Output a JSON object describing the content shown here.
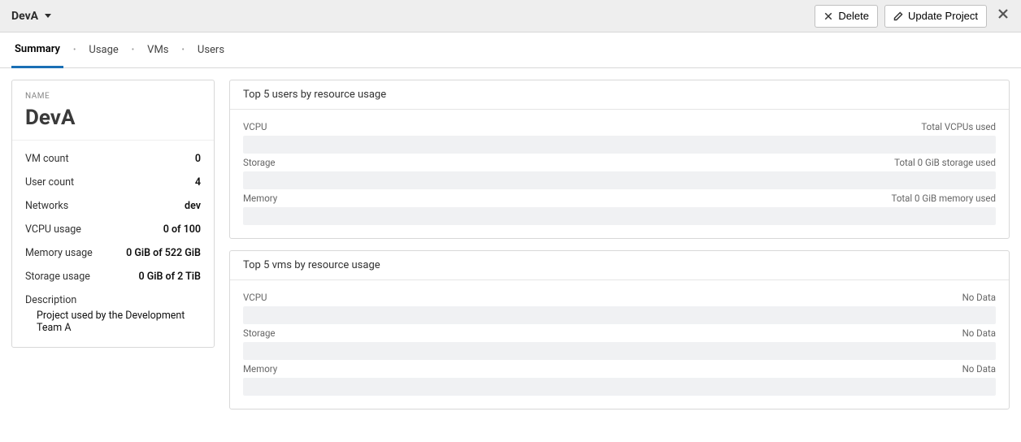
{
  "header": {
    "title": "DevA",
    "delete_label": "Delete",
    "update_label": "Update Project"
  },
  "tabs": {
    "summary": "Summary",
    "usage": "Usage",
    "vms": "VMs",
    "users": "Users"
  },
  "side": {
    "name_label": "NAME",
    "name_value": "DevA",
    "rows": {
      "vm_count_label": "VM count",
      "vm_count_value": "0",
      "user_count_label": "User count",
      "user_count_value": "4",
      "networks_label": "Networks",
      "networks_value": "dev",
      "vcpu_usage_label": "VCPU usage",
      "vcpu_usage_value": "0 of 100",
      "memory_usage_label": "Memory usage",
      "memory_usage_value": "0 GiB of 522 GiB",
      "storage_usage_label": "Storage usage",
      "storage_usage_value": "0 GiB of 2 TiB",
      "description_label": "Description",
      "description_value": "Project used by the Development Team A"
    }
  },
  "cards": {
    "users": {
      "title": "Top 5 users by resource usage",
      "vcpu_label": "VCPU",
      "vcpu_right": "Total VCPUs used",
      "storage_label": "Storage",
      "storage_right": "Total 0 GiB storage used",
      "memory_label": "Memory",
      "memory_right": "Total 0 GiB memory used"
    },
    "vms": {
      "title": "Top 5 vms by resource usage",
      "vcpu_label": "VCPU",
      "vcpu_right": "No Data",
      "storage_label": "Storage",
      "storage_right": "No Data",
      "memory_label": "Memory",
      "memory_right": "No Data"
    }
  }
}
